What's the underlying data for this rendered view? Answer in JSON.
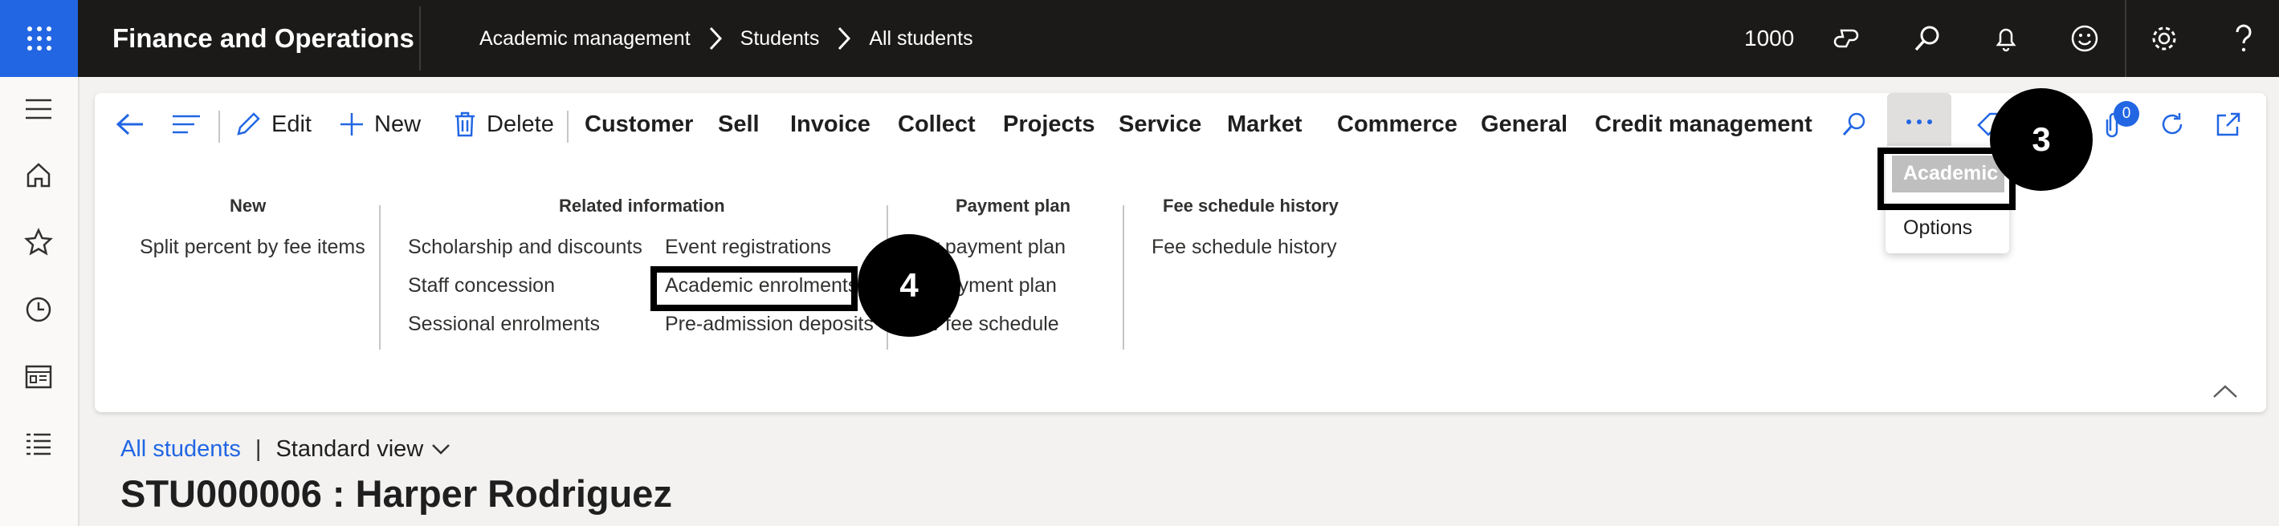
{
  "topbar": {
    "app_title": "Finance and Operations",
    "breadcrumbs": [
      "Academic management",
      "Students",
      "All students"
    ],
    "company": "1000",
    "icons": [
      "waffle-icon",
      "copilot-icon",
      "search-icon",
      "bell-icon",
      "smiley-icon",
      "gear-icon",
      "help-icon"
    ]
  },
  "actionbar": {
    "edit": "Edit",
    "new": "New",
    "delete": "Delete",
    "tabs": [
      "Customer",
      "Sell",
      "Invoice",
      "Collect",
      "Projects",
      "Service",
      "Market",
      "Commerce",
      "General",
      "Credit management"
    ],
    "attachment_count": "0"
  },
  "groups": {
    "new": {
      "title": "New",
      "items": [
        "Split percent by fee items"
      ]
    },
    "related": {
      "title": "Related information",
      "col1": [
        "Scholarship and discounts",
        "Staff concession",
        "Sessional enrolments"
      ],
      "col2": [
        "Event registrations",
        "Academic enrolments",
        "Pre-admission deposits"
      ]
    },
    "payment": {
      "title": "Payment plan",
      "items": [
        "ew payment plan",
        "te payment plan",
        "ew fee schedule"
      ]
    },
    "fee": {
      "title": "Fee schedule history",
      "items": [
        "Fee schedule history"
      ]
    }
  },
  "dropdown": {
    "items": [
      "Academic",
      "Options"
    ]
  },
  "markers": {
    "step3": "3",
    "step4": "4"
  },
  "page": {
    "crumb": "All students",
    "separator": "|",
    "view": "Standard view",
    "title": "STU000006 : Harper Rodriguez"
  },
  "colors": {
    "accent": "#2266e3",
    "topbar": "#1b1a19",
    "link": "#2266e3"
  }
}
